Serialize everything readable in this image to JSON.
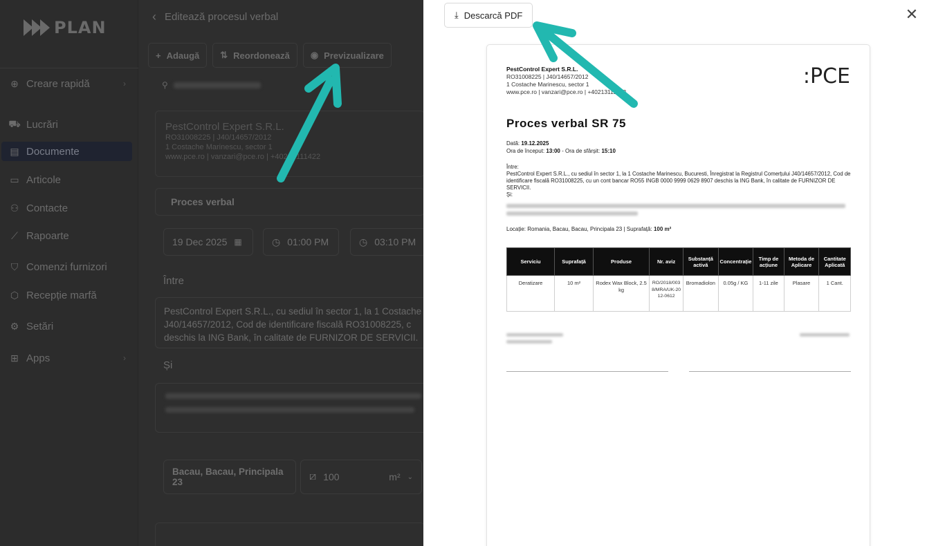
{
  "sidebar": {
    "logo_text": "PLAN",
    "items": [
      {
        "icon": "plus-circle-icon",
        "label": "Creare rapidă"
      },
      {
        "icon": "truck-icon",
        "label": "Lucrări"
      },
      {
        "icon": "document-icon",
        "label": "Documente"
      },
      {
        "icon": "box-icon",
        "label": "Articole"
      },
      {
        "icon": "users-icon",
        "label": "Contacte"
      },
      {
        "icon": "chart-icon",
        "label": "Rapoarte"
      },
      {
        "icon": "cart-icon",
        "label": "Comenzi furnizori"
      },
      {
        "icon": "package-icon",
        "label": "Recepție marfă"
      },
      {
        "icon": "gear-icon",
        "label": "Setări"
      },
      {
        "icon": "grid-icon",
        "label": "Apps"
      }
    ]
  },
  "editor": {
    "title": "Editează procesul verbal",
    "toolbar": {
      "add": "Adaugă",
      "reorder": "Reordonează",
      "preview": "Previzualizare"
    },
    "company_name": "PestControl Expert S.R.L.",
    "company_line1": "RO31008225 | J40/14657/2012",
    "company_line2": "1 Costache Marinescu, sector 1",
    "company_line3": "www.pce.ro | vanzari@pce.ro | +40213111422",
    "doc_type": "Proces verbal",
    "date": "19 Dec 2025",
    "start_time": "01:00 PM",
    "end_time": "03:10 PM",
    "label_between": "Între",
    "between_line1": "PestControl Expert S.R.L., cu sediul în sector 1, la 1 Costache",
    "between_line2": "J40/14657/2012, Cod de identificare fiscală RO31008225, c",
    "between_line3": "deschis la ING Bank, în calitate de FURNIZOR DE SERVICII.",
    "label_and": "Și",
    "location": "Bacau, Bacau, Principala 23",
    "surface": "100",
    "surface_unit": "m²"
  },
  "preview": {
    "download_label": "Descarcă PDF",
    "logo": ":PCE",
    "company_name": "PestControl Expert S.R.L.",
    "company_line1": "RO31008225 | J40/14657/2012",
    "company_line2": "1 Costache Marinescu, sector 1",
    "company_line3": "www.pce.ro | vanzari@pce.ro | +40213111422",
    "title": "Proces verbal SR 75",
    "date_label": "Dată:",
    "date_value": "19.12.2025",
    "start_label": "Ora de început:",
    "start_value": "13:00",
    "end_label": "Ora de sfârșit:",
    "end_value": "15:10",
    "between_label": "Între:",
    "between_text": "PestControl Expert S.R.L., cu sediul în sector 1, la 1 Costache Marinescu, Bucuresti, Înregistrat la Registrul Comerțului J40/14657/2012, Cod de identificare fiscală RO31008225, cu un cont bancar RO55 INGB 0000 9999 0629 8907 deschis la ING Bank, în calitate de FURNIZOR DE SERVICII.",
    "and_label": "Și:",
    "location_label": "Locație:",
    "location_value": "Romania, Bacau, Bacau, Principala 23",
    "surface_label": "Suprafață:",
    "surface_value": "100 m²",
    "table_headers": [
      "Serviciu",
      "Suprafață",
      "Produse",
      "Nr. aviz",
      "Substanță activă",
      "Concentrație",
      "Timp de acțiune",
      "Metoda de Aplicare",
      "Cantitate Aplicată"
    ],
    "table_rows": [
      [
        "Deratizare",
        "10 m²",
        "Rodex Wax Block, 2.5 kg",
        "RO/2018/0038/MRA/UK-2012-0612",
        "Bromadiolon",
        "0.05g / KG",
        "1-11 zile",
        "Plasare",
        "1 Cant."
      ]
    ]
  }
}
